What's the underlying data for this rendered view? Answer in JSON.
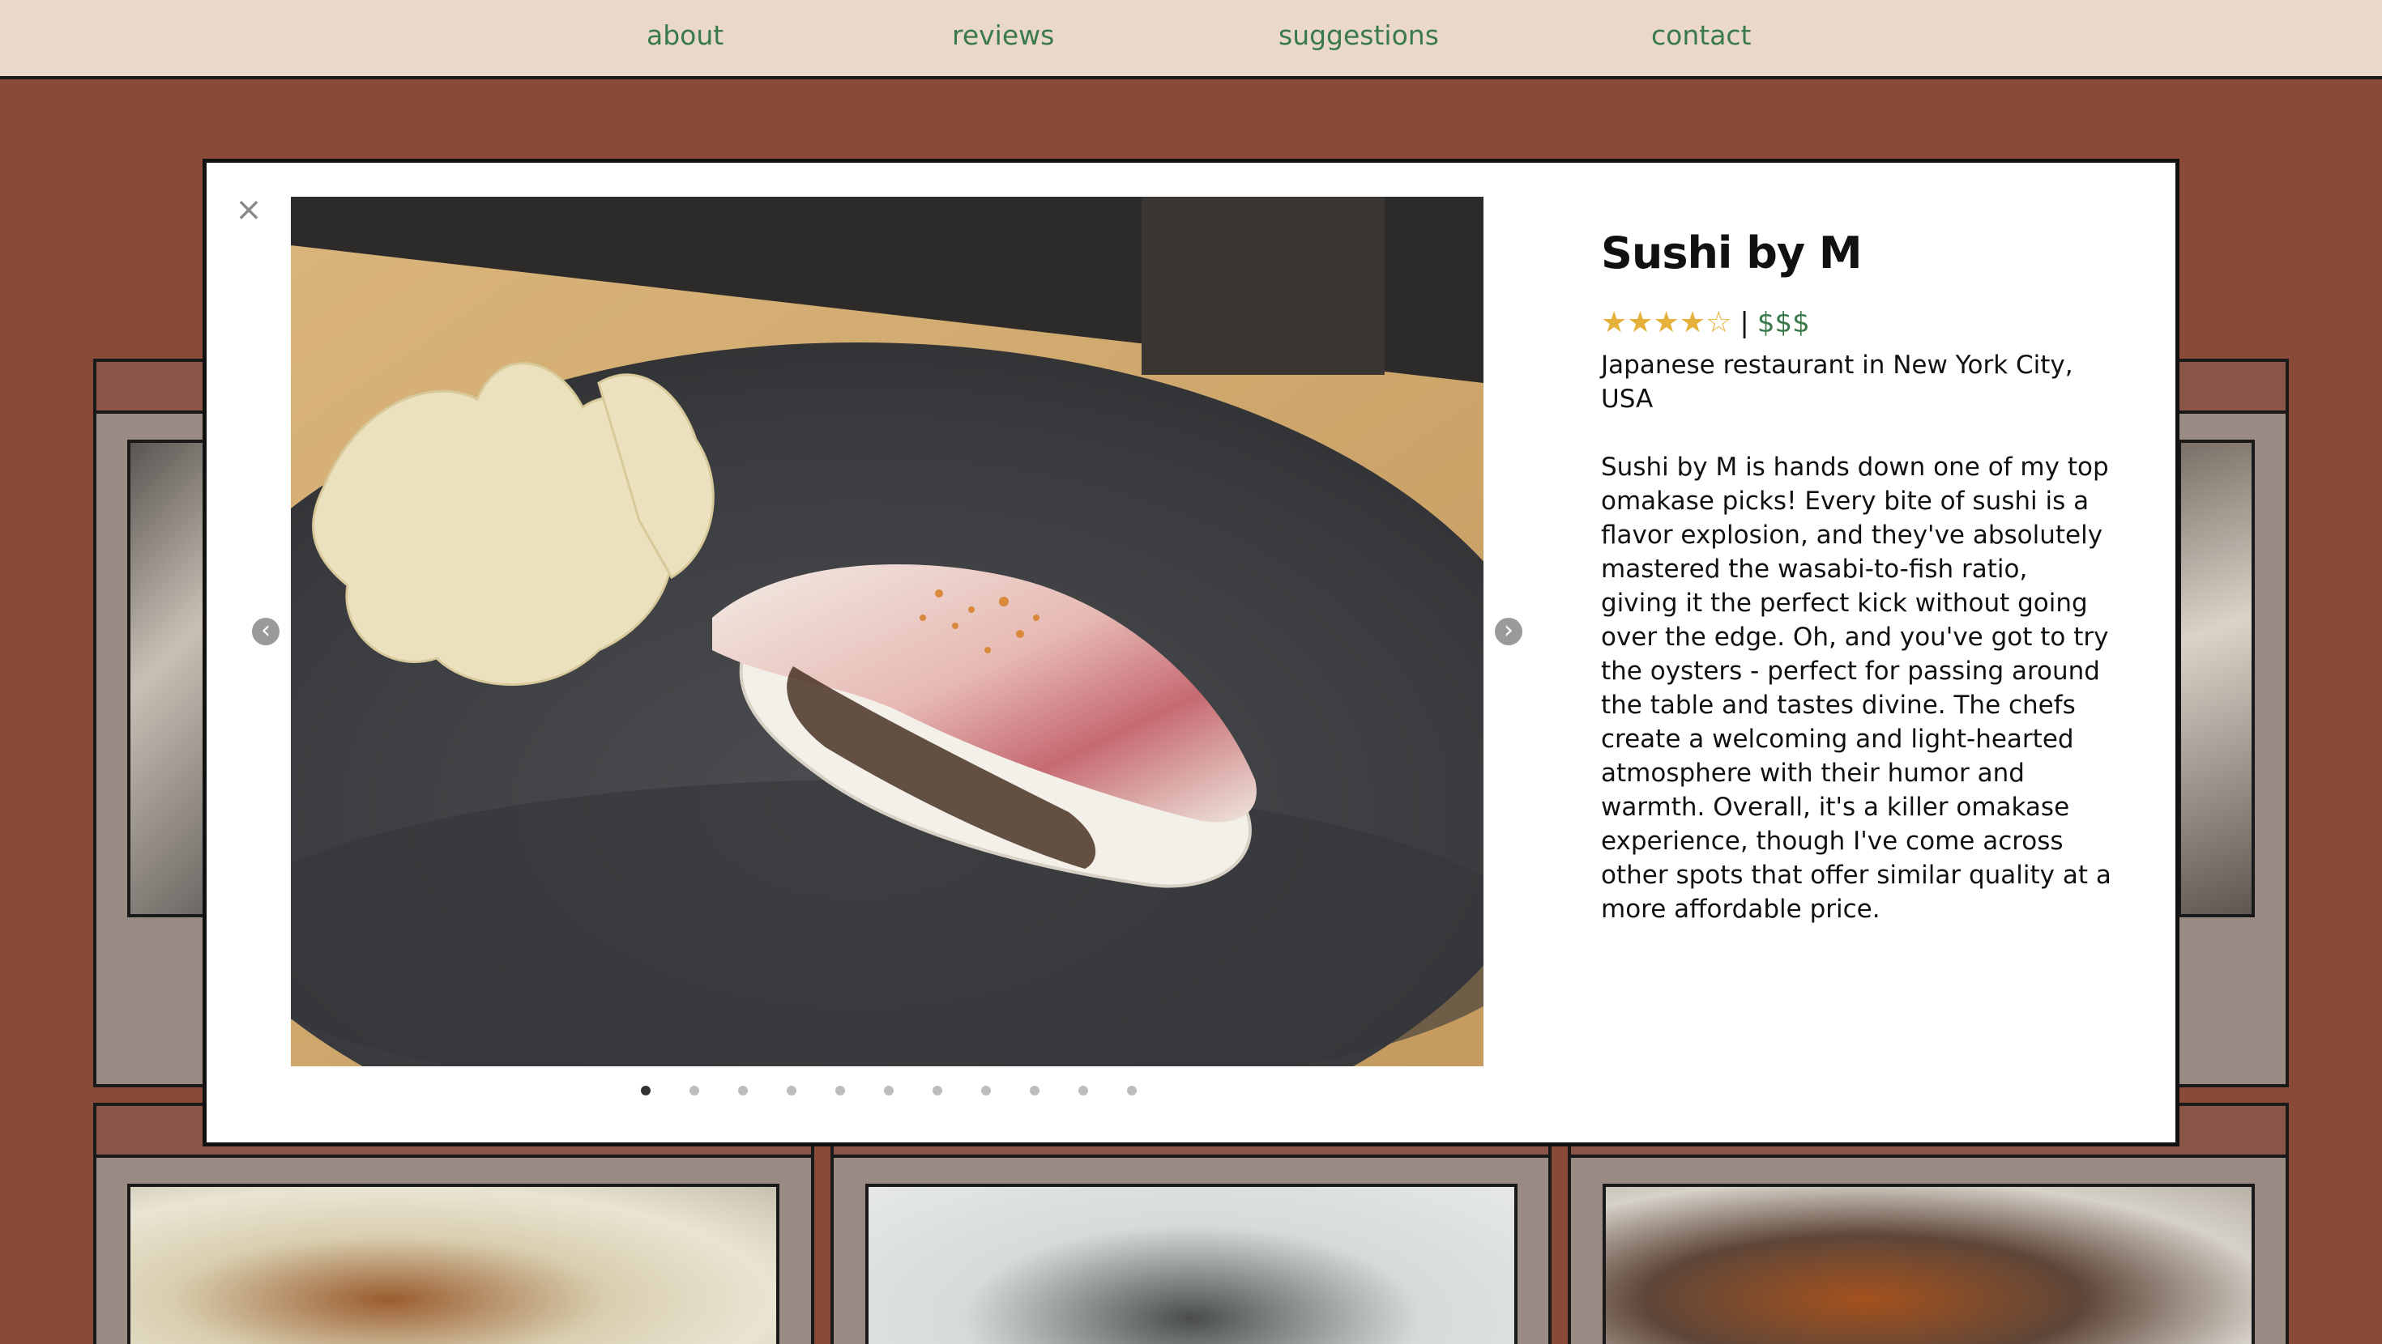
{
  "nav": {
    "items": [
      {
        "label": "about"
      },
      {
        "label": "reviews"
      },
      {
        "label": "suggestions"
      },
      {
        "label": "contact"
      }
    ]
  },
  "modal": {
    "close_label": "×",
    "prev_icon": "‹",
    "next_icon": "›",
    "title": "Sushi by M",
    "rating": 4,
    "rating_max": 5,
    "stars_text": "★★★★☆",
    "separator": "|",
    "price": "$$$",
    "location": "Japanese restaurant in New York City, USA",
    "description": "Sushi by M is hands down one of my top omakase picks! Every bite of sushi is a flavor explosion, and they've absolutely mastered the wasabi-to-fish ratio, giving it the perfect kick without going over the edge. Oh, and you've got to try the oysters - perfect for passing around the table and tastes divine. The chefs create a welcoming and light-hearted atmosphere with their humor and warmth. Overall, it's a killer omakase experience, though I've come across other spots that offer similar quality at a more affordable price.",
    "photo_count": 11,
    "active_photo": 1
  },
  "colors": {
    "page_bg": "#8a4a38",
    "nav_bg": "#ead9cb",
    "link": "#3a7a4a",
    "star": "#e5b13a"
  }
}
